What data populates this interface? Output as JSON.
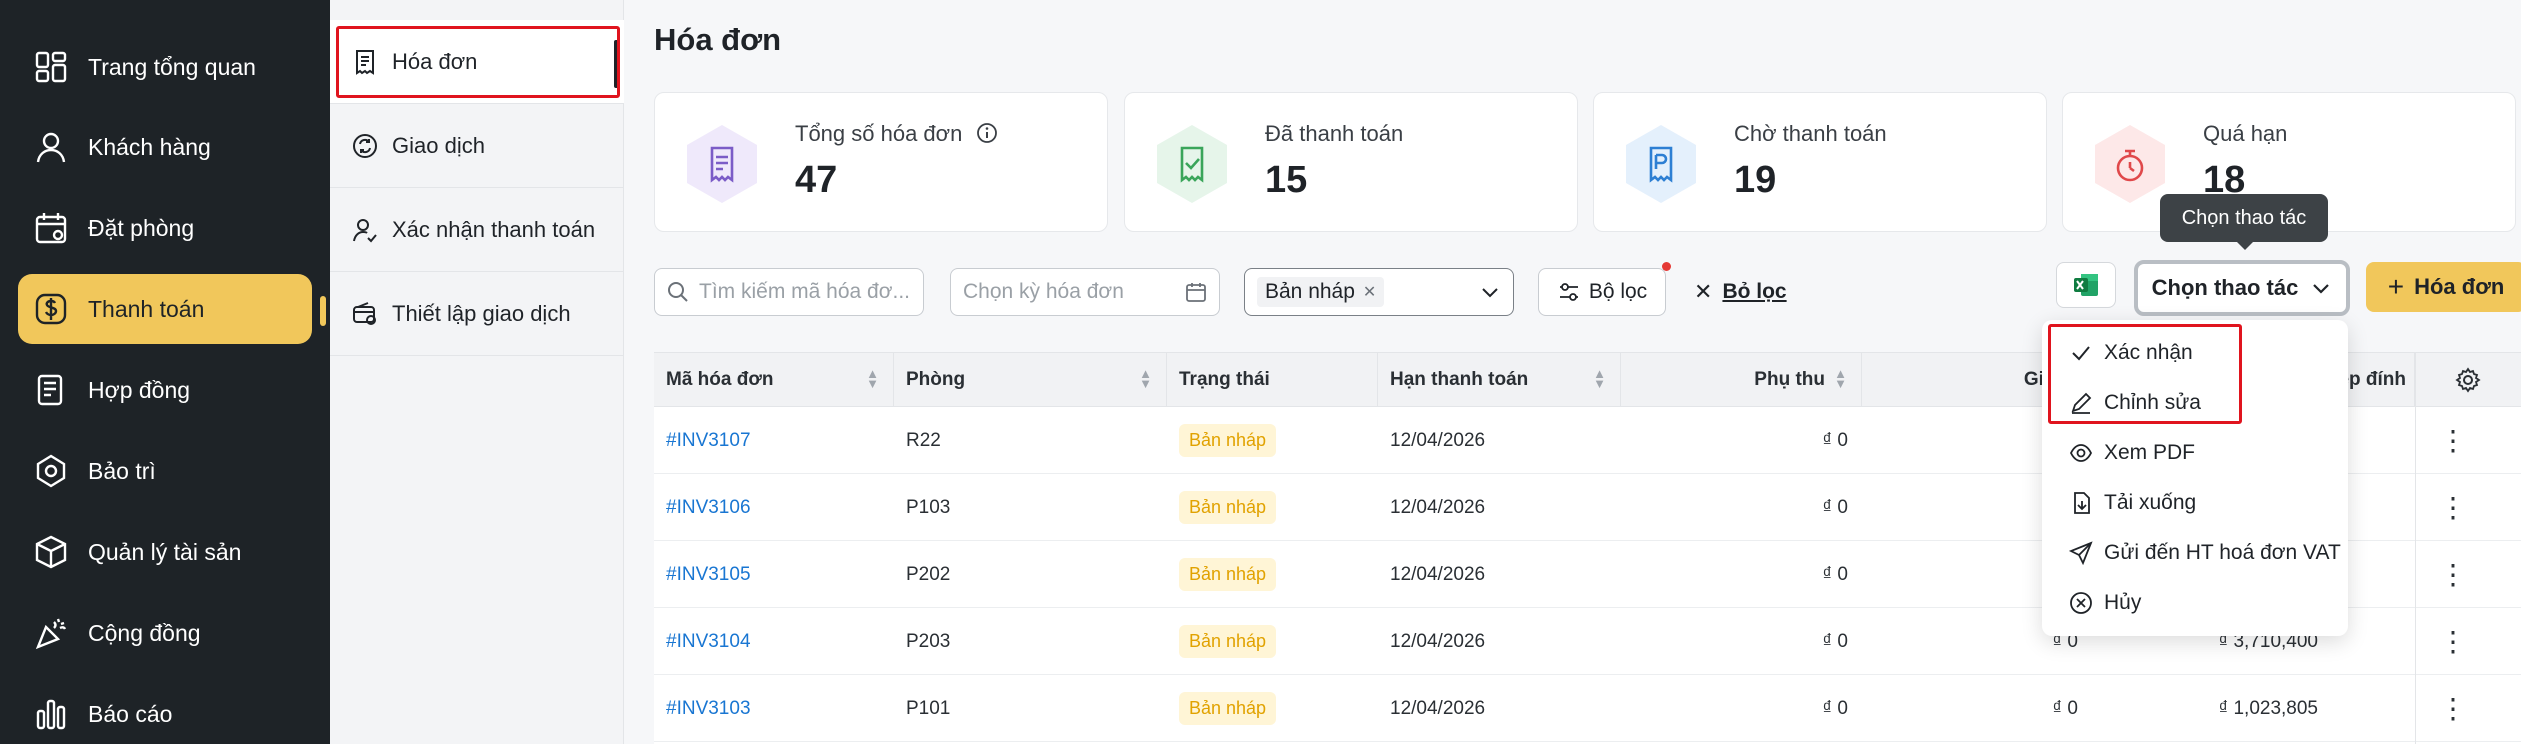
{
  "sidebar": {
    "items": [
      {
        "label": "Trang tổng quan",
        "icon": "dashboard-icon"
      },
      {
        "label": "Khách hàng",
        "icon": "user-icon"
      },
      {
        "label": "Đặt phòng",
        "icon": "calendar-icon"
      },
      {
        "label": "Thanh toán",
        "icon": "dollar-icon",
        "active": true
      },
      {
        "label": "Hợp đồng",
        "icon": "contract-icon"
      },
      {
        "label": "Bảo trì",
        "icon": "hexagon-icon"
      },
      {
        "label": "Quản lý tài sản",
        "icon": "box-icon"
      },
      {
        "label": "Cộng đồng",
        "icon": "party-icon"
      },
      {
        "label": "Báo cáo",
        "icon": "bar-chart-icon"
      }
    ]
  },
  "subnav": {
    "items": [
      {
        "label": "Hóa đơn",
        "icon": "invoice-icon",
        "active": true
      },
      {
        "label": "Giao dịch",
        "icon": "refresh-icon"
      },
      {
        "label": "Xác nhận thanh toán",
        "icon": "user-check-icon"
      },
      {
        "label": "Thiết lập giao dịch",
        "icon": "settings-wallet-icon"
      }
    ]
  },
  "page": {
    "title": "Hóa đơn"
  },
  "stats": [
    {
      "label": "Tổng số hóa đơn",
      "value": "47",
      "color": "#7b5cc7",
      "bg": "#efe9fb",
      "icon": "invoice-icon"
    },
    {
      "label": "Đã thanh toán",
      "value": "15",
      "color": "#3aa55a",
      "bg": "#e6f5ea",
      "icon": "invoice-check-icon"
    },
    {
      "label": "Chờ thanh toán",
      "value": "19",
      "color": "#2d7fd3",
      "bg": "#e4f0fc",
      "icon": "invoice-pending-icon"
    },
    {
      "label": "Quá hạn",
      "value": "18",
      "color": "#e0484a",
      "bg": "#fde8e8",
      "icon": "timer-icon"
    }
  ],
  "toolbar": {
    "search_placeholder": "Tìm kiếm mã hóa đơ...",
    "period_placeholder": "Chọn kỳ hóa đơn",
    "status_chip": "Bản nháp",
    "filter_label": "Bộ lọc",
    "clear_filter_label": "Bỏ lọc",
    "actions_label": "Chọn thao tác",
    "add_label": "Hóa đơn",
    "tooltip": "Chọn thao tác"
  },
  "table": {
    "columns": [
      "Mã hóa đơn",
      "Phòng",
      "Trạng thái",
      "Hạn thanh toán",
      "Phụ thu",
      "Giảm t",
      "Tệp đính"
    ],
    "rows": [
      {
        "id": "#INV3107",
        "room": "R22",
        "status": "Bản nháp",
        "due": "12/04/2026",
        "surcharge": "₫ 0",
        "discount": "",
        "total": ""
      },
      {
        "id": "#INV3106",
        "room": "P103",
        "status": "Bản nháp",
        "due": "12/04/2026",
        "surcharge": "₫ 0",
        "discount": "",
        "total": ""
      },
      {
        "id": "#INV3105",
        "room": "P202",
        "status": "Bản nháp",
        "due": "12/04/2026",
        "surcharge": "₫ 0",
        "discount": "",
        "total": ""
      },
      {
        "id": "#INV3104",
        "room": "P203",
        "status": "Bản nháp",
        "due": "12/04/2026",
        "surcharge": "₫ 0",
        "discount": "₫ 0",
        "total": "₫ 3,710,400"
      },
      {
        "id": "#INV3103",
        "room": "P101",
        "status": "Bản nháp",
        "due": "12/04/2026",
        "surcharge": "₫ 0",
        "discount": "₫ 0",
        "total": "₫ 1,023,805"
      }
    ]
  },
  "menu": {
    "items": [
      {
        "label": "Xác nhận",
        "icon": "check-icon"
      },
      {
        "label": "Chỉnh sửa",
        "icon": "pencil-icon"
      },
      {
        "label": "Xem PDF",
        "icon": "eye-icon"
      },
      {
        "label": "Tải xuống",
        "icon": "download-icon"
      },
      {
        "label": "Gửi đến HT hoá đơn VAT",
        "icon": "send-icon"
      },
      {
        "label": "Hủy",
        "icon": "cancel-icon"
      }
    ]
  },
  "colors": {
    "accent": "#f1c75b",
    "sidebar_bg": "#1e2327",
    "highlight_red": "#e0141e",
    "link": "#1976d2"
  }
}
